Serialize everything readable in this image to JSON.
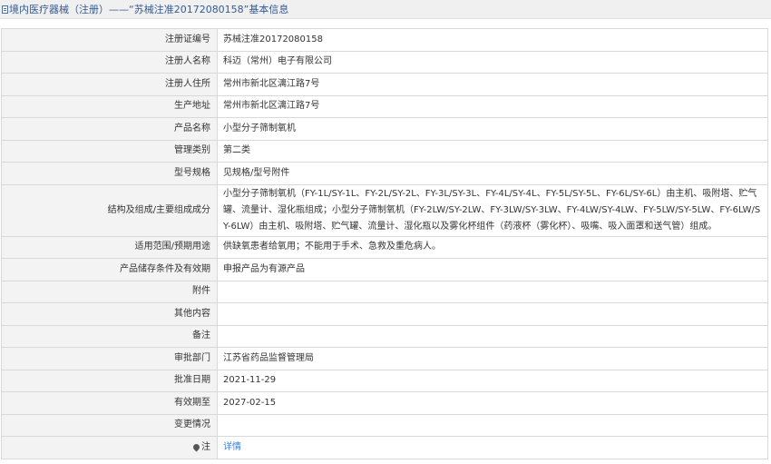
{
  "page": {
    "title": "境内医疗器械（注册）——“苏械注准20172080158”基本信息"
  },
  "fields": [
    {
      "label": "注册证编号",
      "value": "苏械注准20172080158"
    },
    {
      "label": "注册人名称",
      "value": "科迈（常州）电子有限公司"
    },
    {
      "label": "注册人住所",
      "value": "常州市新北区漓江路7号"
    },
    {
      "label": "生产地址",
      "value": "常州市新北区漓江路7号"
    },
    {
      "label": "产品名称",
      "value": "小型分子筛制氧机"
    },
    {
      "label": "管理类别",
      "value": "第二类"
    },
    {
      "label": "型号规格",
      "value": "见规格/型号附件"
    },
    {
      "label": "结构及组成/主要组成成分",
      "value": "小型分子筛制氧机（FY-1L/SY-1L、FY-2L/SY-2L、FY-3L/SY-3L、FY-4L/SY-4L、FY-5L/SY-5L、FY-6L/SY-6L）由主机、吸附塔、贮气罐、流量计、湿化瓶组成；小型分子筛制氧机（FY-2LW/SY-2LW、FY-3LW/SY-3LW、FY-4LW/SY-4LW、FY-5LW/SY-5LW、FY-6LW/SY-6LW）由主机、吸附塔、贮气罐、流量计、湿化瓶以及雾化杯组件（药液杯（雾化杯）、吸嘴、吸入面罩和送气管）组成。"
    },
    {
      "label": "适用范围/预期用途",
      "value": "供缺氧患者给氧用；不能用于手术、急救及重危病人。"
    },
    {
      "label": "产品储存条件及有效期",
      "value": "申报产品为有源产品"
    },
    {
      "label": "附件",
      "value": ""
    },
    {
      "label": "其他内容",
      "value": ""
    },
    {
      "label": "备注",
      "value": ""
    },
    {
      "label": "审批部门",
      "value": "江苏省药品监督管理局"
    },
    {
      "label": "批准日期",
      "value": "2021-11-29"
    },
    {
      "label": "有效期至",
      "value": "2027-02-15"
    },
    {
      "label": "变更情况",
      "value": ""
    }
  ],
  "note_row": {
    "label": "注",
    "icon": "pin-icon",
    "link_text": "详情",
    "link_color": "#3b7fd1"
  }
}
